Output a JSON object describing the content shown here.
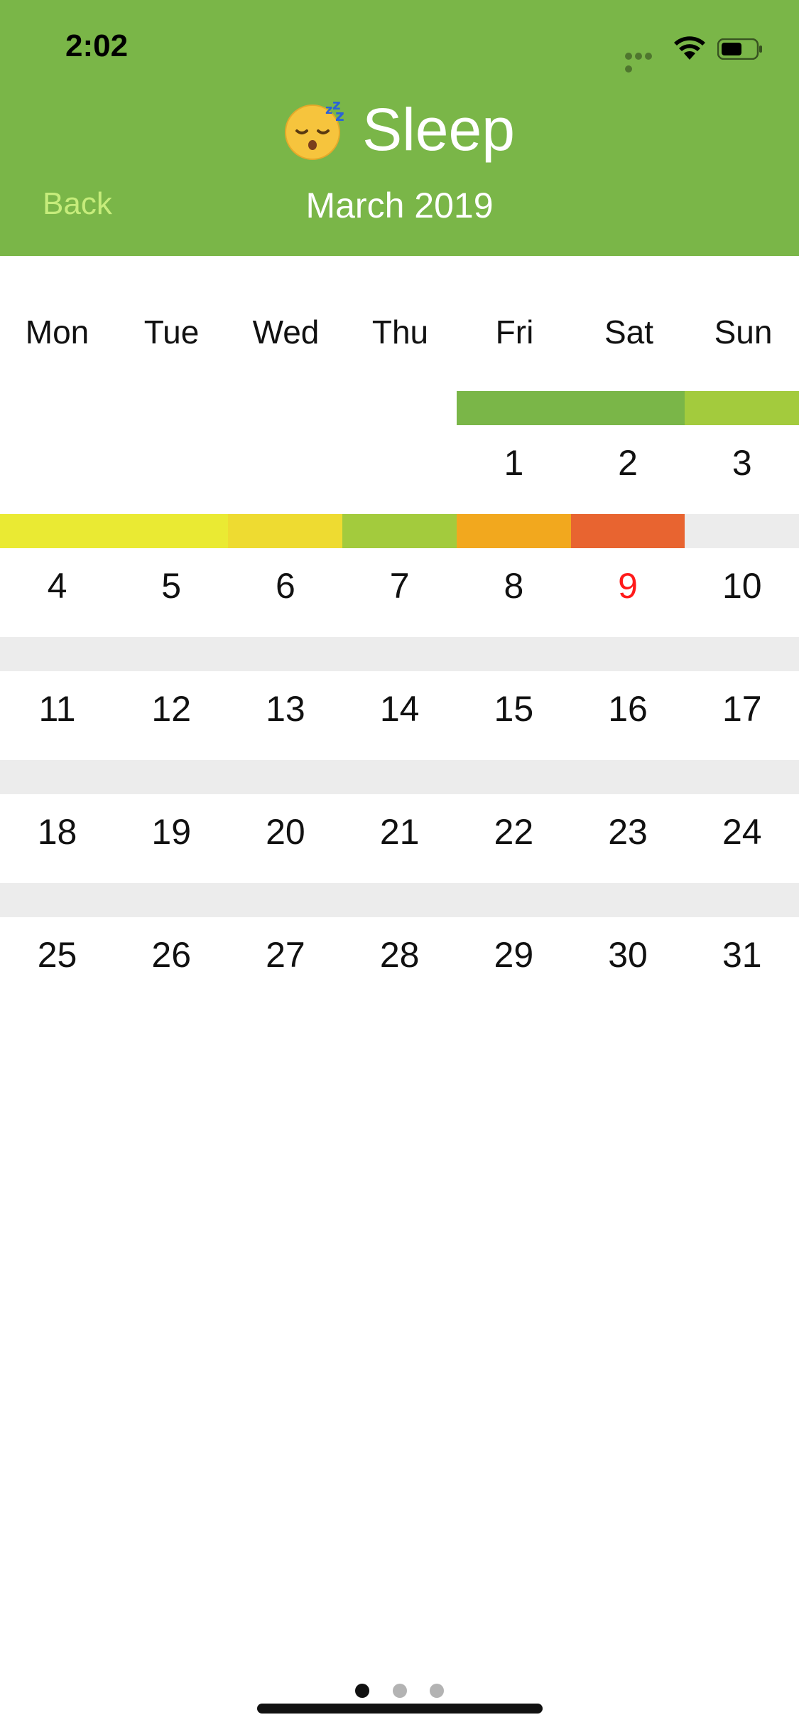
{
  "status": {
    "time": "2:02"
  },
  "header": {
    "title": "Sleep",
    "month": "March 2019",
    "back_label": "Back",
    "icon": "sleeping-face-icon",
    "color": "#7ab648"
  },
  "weekdays": [
    "Mon",
    "Tue",
    "Wed",
    "Thu",
    "Fri",
    "Sat",
    "Sun"
  ],
  "calendar": {
    "highlight_day": "9",
    "rows": [
      {
        "days": [
          "",
          "",
          "",
          "",
          "1",
          "2",
          "3"
        ],
        "bar_colors": [
          "",
          "",
          "",
          "",
          "#7ab648",
          "#7ab648",
          "#a3cb3d"
        ]
      },
      {
        "days": [
          "4",
          "5",
          "6",
          "7",
          "8",
          "9",
          "10"
        ],
        "bar_colors": [
          "#eaea33",
          "#eaea33",
          "#eedb31",
          "#a3cb3d",
          "#f2a81e",
          "#e86430",
          "#ececec"
        ]
      },
      {
        "days": [
          "11",
          "12",
          "13",
          "14",
          "15",
          "16",
          "17"
        ],
        "bar_colors": [
          "#ececec",
          "#ececec",
          "#ececec",
          "#ececec",
          "#ececec",
          "#ececec",
          "#ececec"
        ]
      },
      {
        "days": [
          "18",
          "19",
          "20",
          "21",
          "22",
          "23",
          "24"
        ],
        "bar_colors": [
          "#ececec",
          "#ececec",
          "#ececec",
          "#ececec",
          "#ececec",
          "#ececec",
          "#ececec"
        ]
      },
      {
        "days": [
          "25",
          "26",
          "27",
          "28",
          "29",
          "30",
          "31"
        ],
        "bar_colors": [
          "#ececec",
          "#ececec",
          "#ececec",
          "#ececec",
          "#ececec",
          "#ececec",
          "#ececec"
        ]
      }
    ]
  },
  "pager": {
    "count": 3,
    "active": 1
  }
}
